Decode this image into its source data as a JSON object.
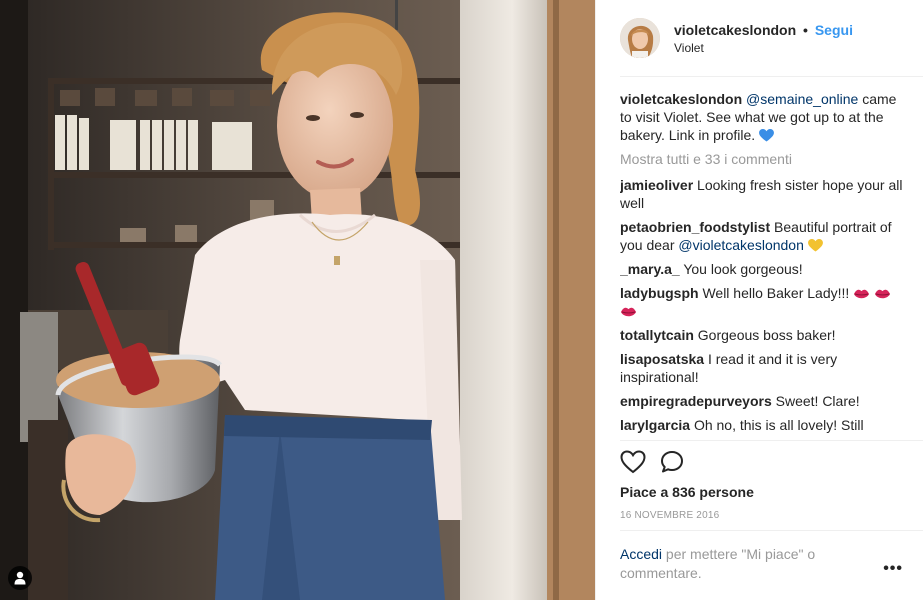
{
  "post": {
    "username": "violetcakeslondon",
    "follow_label": "Segui",
    "separator": "•",
    "location": "Violet"
  },
  "caption": {
    "username": "violetcakeslondon",
    "mention": "@semaine_online",
    "text": "came to visit Violet. See what we got up to at the bakery. Link in profile."
  },
  "show_all_comments": "Mostra tutti e 33 i commenti",
  "comments": [
    {
      "user": "jamieoliver",
      "text": "Looking fresh sister hope your all well"
    },
    {
      "user": "petaobrien_foodstylist",
      "text": "Beautiful portrait of you dear",
      "mention": "@violetcakeslondon"
    },
    {
      "user": "_mary.a_",
      "text": "You look gorgeous!"
    },
    {
      "user": "ladybugsph",
      "text": "Well hello Baker Lady!!!"
    },
    {
      "user": "totallytcain",
      "text": "Gorgeous boss baker!"
    },
    {
      "user": "lisaposatska",
      "text": "I read it and it is very inspirational!"
    },
    {
      "user": "empiregradepurveyors",
      "text": "Sweet! Clare!"
    },
    {
      "user": "larylgarcia",
      "text": "Oh no, this is all lovely! Still"
    }
  ],
  "likes": "Piace a 836 persone",
  "date": "16 NOVEMBRE 2016",
  "login_prompt": {
    "link": "Accedi",
    "text": "per mettere \"Mi piace\" o commentare."
  },
  "more_options": "•••",
  "icons": {
    "like": "heart-icon",
    "comment": "comment-icon",
    "user_tag": "user-tag-icon"
  },
  "colors": {
    "link_blue": "#3897f0",
    "mention_blue": "#003569",
    "muted": "#999999",
    "text": "#262626"
  }
}
